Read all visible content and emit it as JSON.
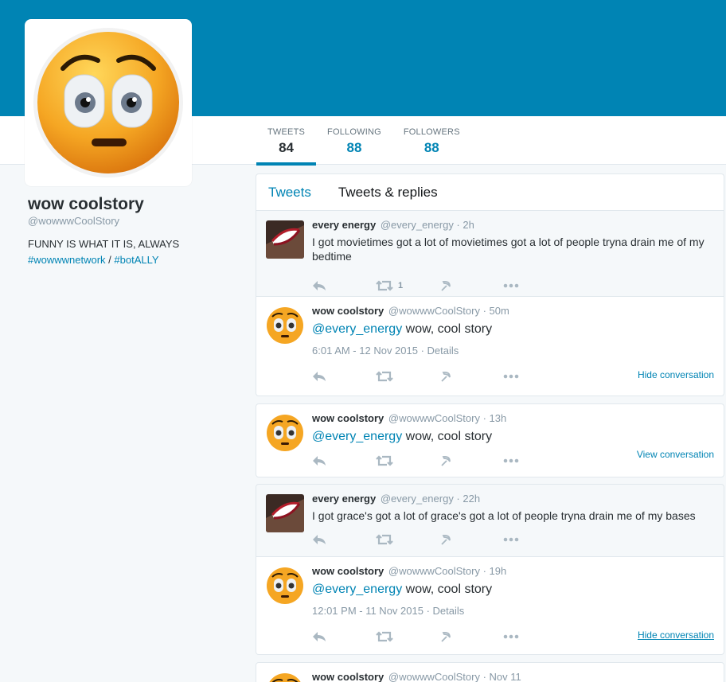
{
  "profile": {
    "name": "wow coolstory",
    "handle": "@wowwwCoolStory",
    "bio": "FUNNY IS WHAT IT IS, ALWAYS",
    "hashtag1": "#wowwwnetwork",
    "separator": "/",
    "hashtag2": "#botALLY"
  },
  "stats": [
    {
      "label": "TWEETS",
      "value": "84"
    },
    {
      "label": "FOLLOWING",
      "value": "88"
    },
    {
      "label": "FOLLOWERS",
      "value": "88"
    }
  ],
  "tabs": {
    "tweets": "Tweets",
    "replies": "Tweets & replies"
  },
  "tweets": [
    {
      "name": "every energy",
      "meta": "@every_energy · 2h",
      "text": "I got movietimes got a lot of movietimes got a lot of people tryna drain me of my bedtime",
      "retweet_count": "1"
    },
    {
      "name": "wow coolstory",
      "meta": "@wowwwCoolStory · 50m",
      "mention": "@every_energy",
      "text": "wow, cool story",
      "timestamp": "6:01 AM - 12 Nov 2015 · Details",
      "convo": "Hide conversation"
    },
    {
      "name": "wow coolstory",
      "meta": "@wowwwCoolStory · 13h",
      "mention": "@every_energy",
      "text": "wow, cool story",
      "convo": "View conversation"
    },
    {
      "name": "every energy",
      "meta": "@every_energy · 22h",
      "text": "I got grace's got a lot of grace's got a lot of people tryna drain me of my bases"
    },
    {
      "name": "wow coolstory",
      "meta": "@wowwwCoolStory · 19h",
      "mention": "@every_energy",
      "text": "wow, cool story",
      "timestamp": "12:01 PM - 11 Nov 2015 · Details",
      "convo": "Hide conversation"
    },
    {
      "name": "wow coolstory",
      "meta": "@wowwwCoolStory · Nov 11"
    }
  ],
  "colors": {
    "banner": "#0084b4",
    "link": "#0084b4"
  }
}
